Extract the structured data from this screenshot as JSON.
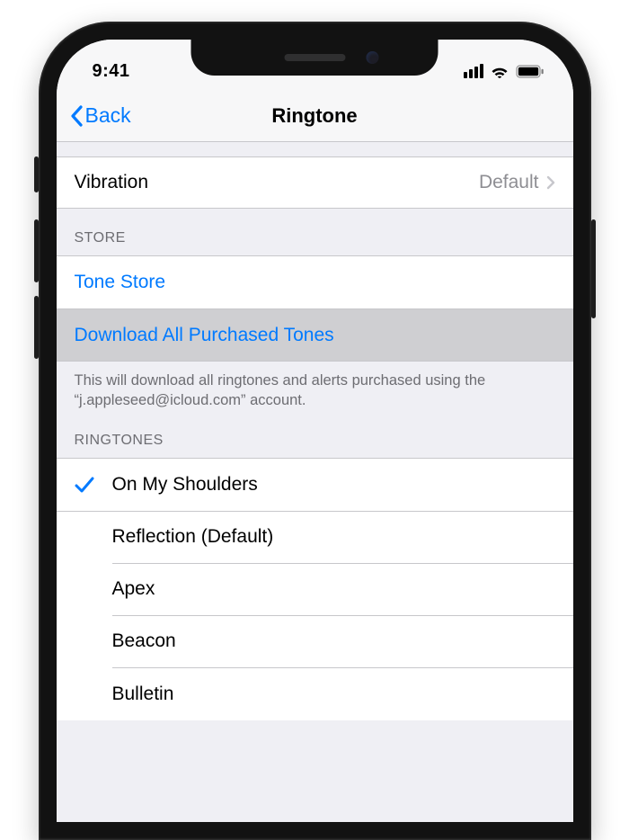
{
  "status": {
    "time": "9:41"
  },
  "nav": {
    "back": "Back",
    "title": "Ringtone"
  },
  "vibration": {
    "label": "Vibration",
    "value": "Default"
  },
  "store": {
    "header": "STORE",
    "tone_store": "Tone Store",
    "download_all": "Download All Purchased Tones",
    "footer": "This will download all ringtones and alerts purchased using the “j.appleseed@icloud.com” account."
  },
  "ringtones": {
    "header": "RINGTONES",
    "selected": "On My Shoulders",
    "items": [
      "On My Shoulders",
      "Reflection (Default)",
      "Apex",
      "Beacon",
      "Bulletin"
    ]
  }
}
